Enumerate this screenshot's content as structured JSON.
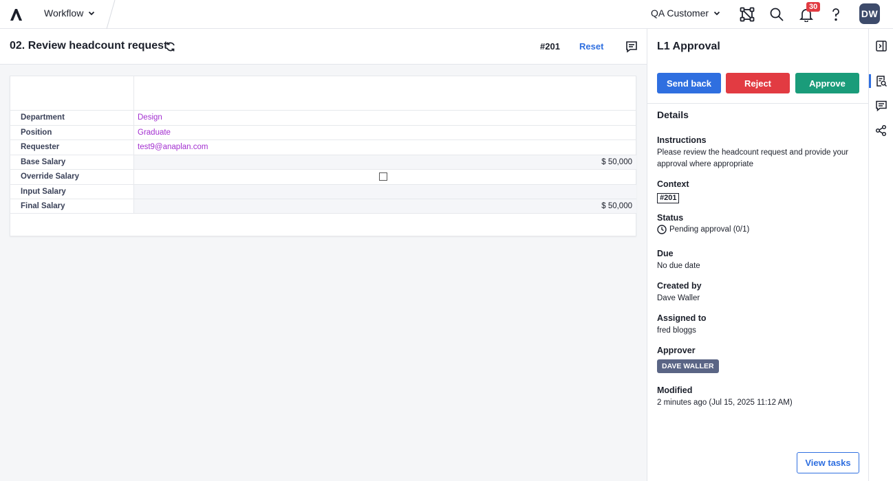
{
  "topbar": {
    "nav_label": "Workflow",
    "customer_label": "QA Customer",
    "notification_count": "30",
    "avatar_initials": "DW"
  },
  "main": {
    "title": "02. Review headcount request",
    "record_id": "#201",
    "reset_label": "Reset"
  },
  "card": {
    "rows": [
      {
        "label": "Department",
        "value": "Design"
      },
      {
        "label": "Position",
        "value": "Graduate"
      },
      {
        "label": "Requester",
        "value": "test9@anaplan.com"
      },
      {
        "label": "Base Salary",
        "value": "$ 50,000"
      },
      {
        "label": "Override Salary",
        "value": ""
      },
      {
        "label": "Input Salary",
        "value": ""
      },
      {
        "label": "Final Salary",
        "value": "$ 50,000"
      }
    ]
  },
  "panel": {
    "title": "L1 Approval",
    "send_back_label": "Send back",
    "reject_label": "Reject",
    "approve_label": "Approve",
    "details_title": "Details",
    "instructions_label": "Instructions",
    "instructions_value": "Please review the headcount request and provide your approval where appropriate",
    "context_label": "Context",
    "context_value": "#201",
    "status_label": "Status",
    "status_value": "Pending approval (0/1)",
    "due_label": "Due",
    "due_value": "No due date",
    "created_by_label": "Created by",
    "created_by_value": "Dave Waller",
    "assigned_to_label": "Assigned to",
    "assigned_to_value": "fred bloggs",
    "approver_label": "Approver",
    "approver_value": "DAVE WALLER",
    "modified_label": "Modified",
    "modified_value": "2 minutes ago (Jul 15, 2025 11:12 AM)",
    "view_tasks_label": "View tasks"
  },
  "colors": {
    "primary": "#2f6fe0",
    "danger": "#e23b42",
    "success": "#1a9c7a",
    "link_value": "#a32fd0"
  }
}
